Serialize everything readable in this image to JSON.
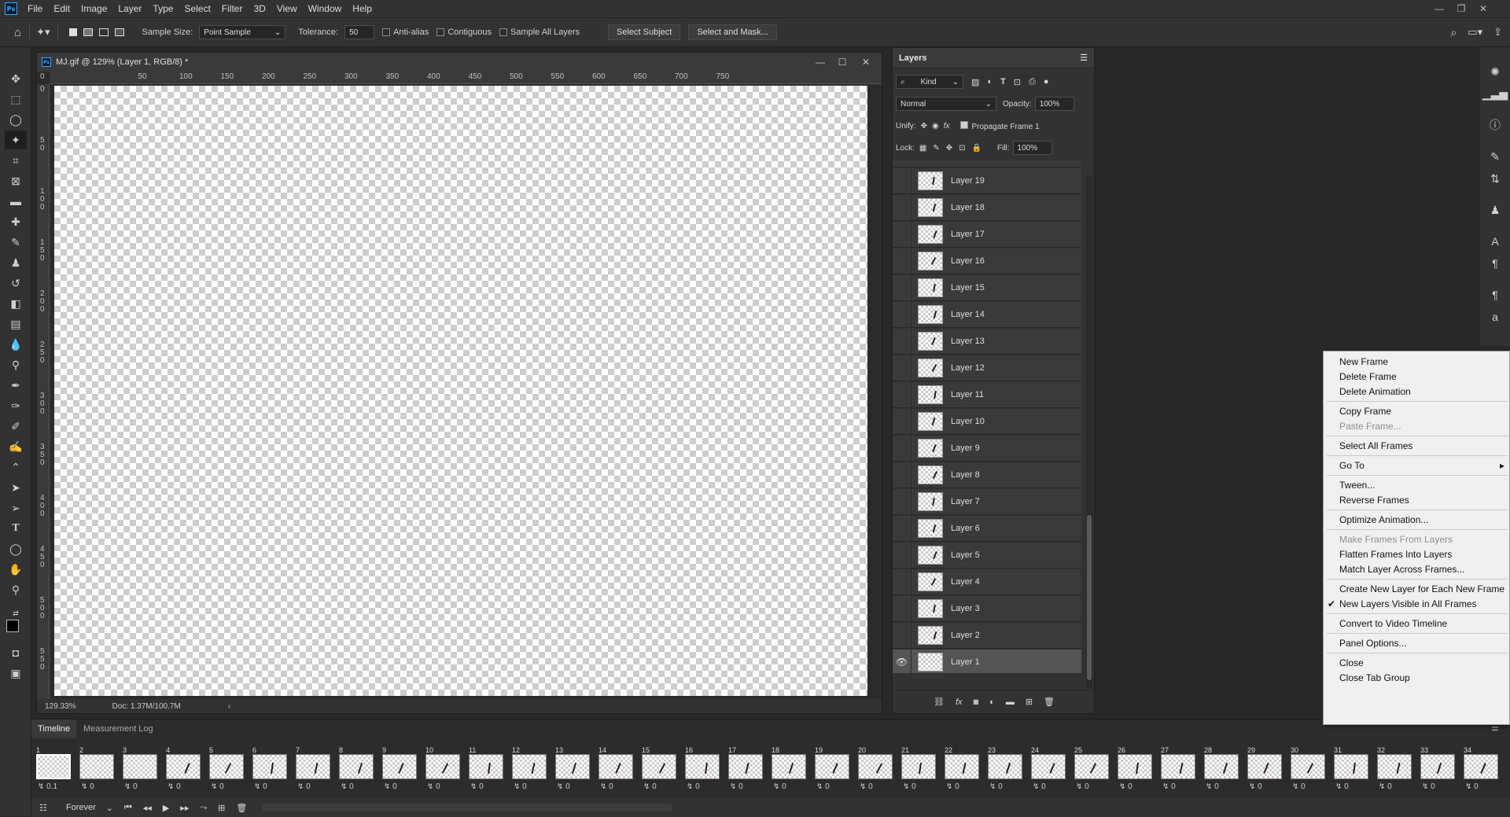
{
  "menubar": {
    "logo": "Ps",
    "items": [
      "File",
      "Edit",
      "Image",
      "Layer",
      "Type",
      "Select",
      "Filter",
      "3D",
      "View",
      "Window",
      "Help"
    ]
  },
  "options": {
    "sample_size_label": "Sample Size:",
    "sample_size_value": "Point Sample",
    "tolerance_label": "Tolerance:",
    "tolerance_value": "50",
    "anti_alias": "Anti-alias",
    "contiguous": "Contiguous",
    "sample_all_layers": "Sample All Layers",
    "select_subject": "Select Subject",
    "select_and_mask": "Select and Mask..."
  },
  "document": {
    "title": "MJ.gif @ 129% (Layer 1, RGB/8) *",
    "zoom": "129.33%",
    "doc_info": "Doc: 1.37M/100.7M",
    "ruler_h": [
      "0",
      "50",
      "100",
      "150",
      "200",
      "250",
      "300",
      "350",
      "400",
      "450",
      "500",
      "550",
      "600",
      "650",
      "700",
      "750"
    ],
    "ruler_v": [
      "0",
      "50",
      "100",
      "150",
      "200",
      "250",
      "300",
      "350",
      "400",
      "450",
      "500",
      "550"
    ]
  },
  "layers": {
    "title": "Layers",
    "kind": "Kind",
    "blend": "Normal",
    "opacity_label": "Opacity:",
    "opacity": "100%",
    "unify_label": "Unify:",
    "propagate": "Propagate Frame 1",
    "lock_label": "Lock:",
    "fill_label": "Fill:",
    "fill": "100%",
    "rows": [
      "Layer 19",
      "Layer 18",
      "Layer 17",
      "Layer 16",
      "Layer 15",
      "Layer 14",
      "Layer 13",
      "Layer 12",
      "Layer 11",
      "Layer 10",
      "Layer 9",
      "Layer 8",
      "Layer 7",
      "Layer 6",
      "Layer 5",
      "Layer 4",
      "Layer 3",
      "Layer 2",
      "Layer 1"
    ],
    "selected": "Layer 1"
  },
  "context_menu": {
    "items": [
      {
        "label": "New Frame",
        "disabled": false
      },
      {
        "label": "Delete Frame",
        "disabled": false
      },
      {
        "label": "Delete Animation",
        "disabled": false
      },
      {
        "label": "Copy Frame",
        "disabled": false
      },
      {
        "label": "Paste Frame...",
        "disabled": true
      },
      {
        "label": "Select All Frames",
        "disabled": false
      },
      {
        "label": "Go To",
        "disabled": false
      },
      {
        "label": "Tween...",
        "disabled": false
      },
      {
        "label": "Reverse Frames",
        "disabled": false
      },
      {
        "label": "Optimize Animation...",
        "disabled": false
      },
      {
        "label": "Make Frames From Layers",
        "disabled": true
      },
      {
        "label": "Flatten Frames Into Layers",
        "disabled": false
      },
      {
        "label": "Match Layer Across Frames...",
        "disabled": false
      },
      {
        "label": "Create New Layer for Each New Frame",
        "disabled": false
      },
      {
        "label": "New Layers Visible in All Frames",
        "disabled": false
      },
      {
        "label": "Convert to Video Timeline",
        "disabled": false
      },
      {
        "label": "Panel Options...",
        "disabled": false
      },
      {
        "label": "Close",
        "disabled": false
      },
      {
        "label": "Close Tab Group",
        "disabled": false
      }
    ],
    "checkmark": "✔",
    "submenu_arrow": "▸"
  },
  "timeline": {
    "tab_timeline": "Timeline",
    "tab_measurement": "Measurement Log",
    "loop": "Forever",
    "frames": [
      "1",
      "2",
      "3",
      "4",
      "5",
      "6",
      "7",
      "8",
      "9",
      "10",
      "11",
      "12",
      "13",
      "14",
      "15",
      "16",
      "17",
      "18",
      "19",
      "20",
      "21",
      "22",
      "23",
      "24",
      "25",
      "26",
      "27",
      "28",
      "29",
      "30",
      "31",
      "32",
      "33",
      "34"
    ],
    "first_delay": "0.1",
    "delay": "0"
  }
}
